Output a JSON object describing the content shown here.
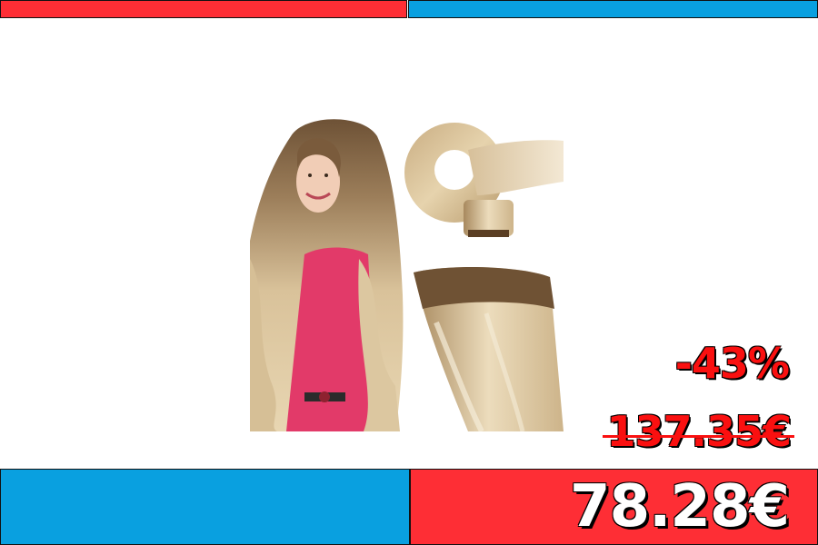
{
  "colors": {
    "red": "#fe2e35",
    "blue": "#09a0e0",
    "discount_red": "#fa1010",
    "white": "#ffffff"
  },
  "product": {
    "image_icon": "hair-extension-photo"
  },
  "pricing": {
    "discount": "-43%",
    "old_price": "137.35€",
    "new_price": "78.28€"
  }
}
